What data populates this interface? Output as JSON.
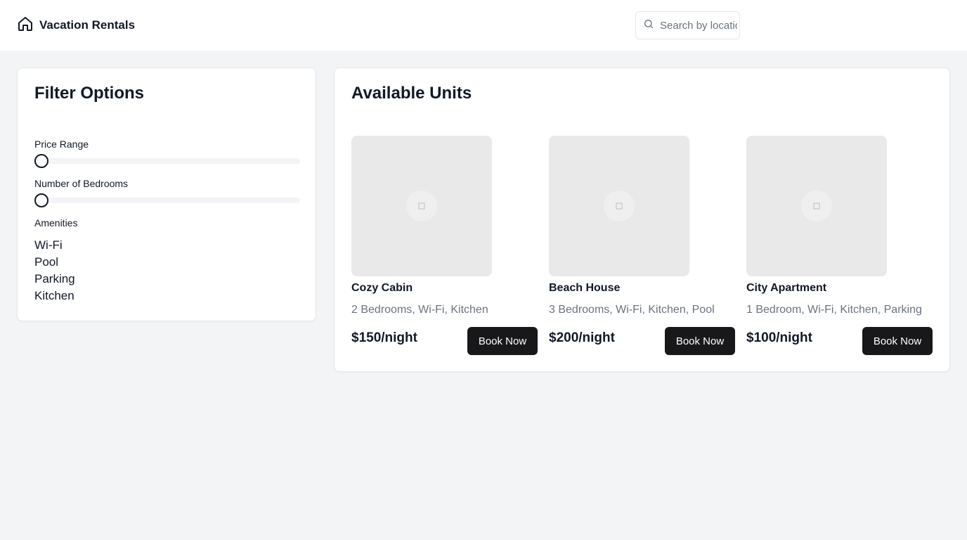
{
  "header": {
    "title": "Vacation Rentals",
    "logo_icon": "home-icon",
    "search": {
      "placeholder": "Search by location",
      "value": ""
    }
  },
  "filters": {
    "title": "Filter Options",
    "price_label": "Price Range",
    "price_value": 0,
    "bedrooms_label": "Number of Bedrooms",
    "bedrooms_value": 0,
    "amenities_label": "Amenities",
    "amenities": [
      "Wi-Fi",
      "Pool",
      "Parking",
      "Kitchen"
    ]
  },
  "units": {
    "title": "Available Units",
    "action_label": "Book Now",
    "image_icon": "image-placeholder-icon",
    "items": [
      {
        "name": "Cozy Cabin",
        "desc": "2 Bedrooms, Wi-Fi, Kitchen",
        "price": "$150/night"
      },
      {
        "name": "Beach House",
        "desc": "3 Bedrooms, Wi-Fi, Kitchen, Pool",
        "price": "$200/night"
      },
      {
        "name": "City Apartment",
        "desc": "1 Bedroom, Wi-Fi, Kitchen, Parking",
        "price": "$100/night"
      }
    ]
  },
  "colors": {
    "page_bg": "#f3f4f6",
    "card_bg": "#ffffff",
    "button_bg": "#18181b",
    "muted_text": "#6b7280",
    "image_bg": "#e9e9e9"
  }
}
